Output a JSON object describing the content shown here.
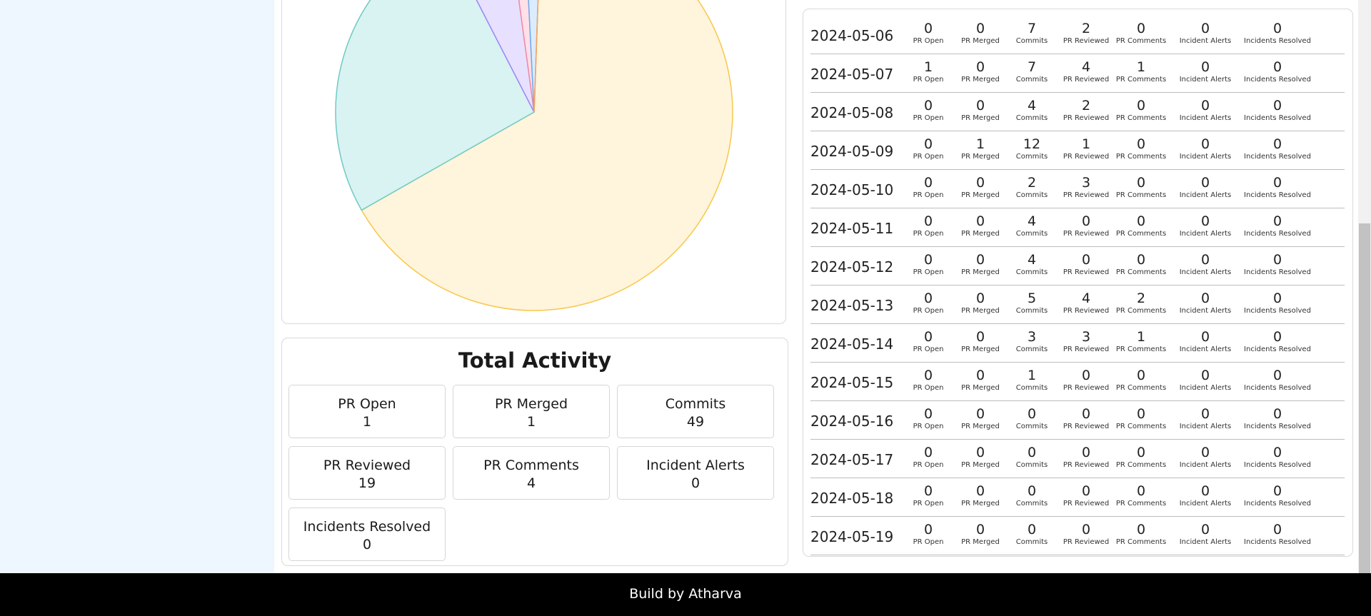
{
  "chart_data": {
    "type": "pie",
    "slices": [
      {
        "name": "Commits",
        "value": 49,
        "fill": "#fff4dc",
        "stroke": "#f7c84a"
      },
      {
        "name": "PR Reviewed",
        "value": 19,
        "fill": "#d9f2f2",
        "stroke": "#6ecbc5"
      },
      {
        "name": "PR Comments",
        "value": 4,
        "fill": "#e8e0ff",
        "stroke": "#9b87f5"
      },
      {
        "name": "PR Open",
        "value": 1,
        "fill": "#ffe0e8",
        "stroke": "#f08aa3"
      },
      {
        "name": "PR Merged",
        "value": 1,
        "fill": "#dcecff",
        "stroke": "#6aaaf0"
      },
      {
        "name": "Incident Alerts",
        "value": 0,
        "fill": "#eeeeee",
        "stroke": "#cccccc"
      },
      {
        "name": "Incidents Resolved",
        "value": 0,
        "fill": "#fff0e0",
        "stroke": "#f5a35c"
      }
    ]
  },
  "total_activity": {
    "title": "Total Activity",
    "stats": [
      {
        "label": "PR Open",
        "value": "1"
      },
      {
        "label": "PR Merged",
        "value": "1"
      },
      {
        "label": "Commits",
        "value": "49"
      },
      {
        "label": "PR Reviewed",
        "value": "19"
      },
      {
        "label": "PR Comments",
        "value": "4"
      },
      {
        "label": "Incident Alerts",
        "value": "0"
      },
      {
        "label": "Incidents Resolved",
        "value": "0"
      }
    ]
  },
  "daily": {
    "metric_labels": [
      "PR Open",
      "PR Merged",
      "Commits",
      "PR Reviewed",
      "PR Comments",
      "Incident Alerts",
      "Incidents Resolved"
    ],
    "rows": [
      {
        "date": "2024-05-06",
        "values": [
          "0",
          "0",
          "7",
          "2",
          "0",
          "0",
          "0"
        ]
      },
      {
        "date": "2024-05-07",
        "values": [
          "1",
          "0",
          "7",
          "4",
          "1",
          "0",
          "0"
        ]
      },
      {
        "date": "2024-05-08",
        "values": [
          "0",
          "0",
          "4",
          "2",
          "0",
          "0",
          "0"
        ]
      },
      {
        "date": "2024-05-09",
        "values": [
          "0",
          "1",
          "12",
          "1",
          "0",
          "0",
          "0"
        ]
      },
      {
        "date": "2024-05-10",
        "values": [
          "0",
          "0",
          "2",
          "3",
          "0",
          "0",
          "0"
        ]
      },
      {
        "date": "2024-05-11",
        "values": [
          "0",
          "0",
          "4",
          "0",
          "0",
          "0",
          "0"
        ]
      },
      {
        "date": "2024-05-12",
        "values": [
          "0",
          "0",
          "4",
          "0",
          "0",
          "0",
          "0"
        ]
      },
      {
        "date": "2024-05-13",
        "values": [
          "0",
          "0",
          "5",
          "4",
          "2",
          "0",
          "0"
        ]
      },
      {
        "date": "2024-05-14",
        "values": [
          "0",
          "0",
          "3",
          "3",
          "1",
          "0",
          "0"
        ]
      },
      {
        "date": "2024-05-15",
        "values": [
          "0",
          "0",
          "1",
          "0",
          "0",
          "0",
          "0"
        ]
      },
      {
        "date": "2024-05-16",
        "values": [
          "0",
          "0",
          "0",
          "0",
          "0",
          "0",
          "0"
        ]
      },
      {
        "date": "2024-05-17",
        "values": [
          "0",
          "0",
          "0",
          "0",
          "0",
          "0",
          "0"
        ]
      },
      {
        "date": "2024-05-18",
        "values": [
          "0",
          "0",
          "0",
          "0",
          "0",
          "0",
          "0"
        ]
      },
      {
        "date": "2024-05-19",
        "values": [
          "0",
          "0",
          "0",
          "0",
          "0",
          "0",
          "0"
        ]
      }
    ]
  },
  "footer": {
    "text": "Build by Atharva"
  }
}
